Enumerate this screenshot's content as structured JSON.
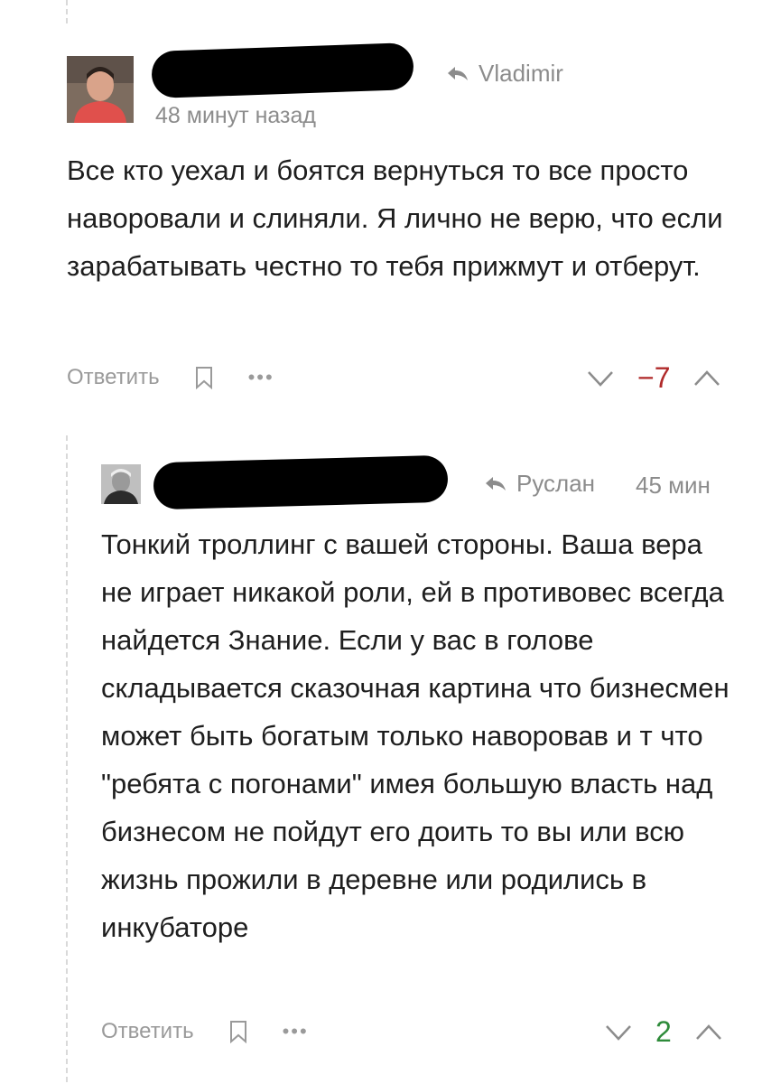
{
  "comments": [
    {
      "reply_to": "Vladimir",
      "time": "48 минут назад",
      "text": "Все кто уехал и боятся вернуться то все просто наворовали и слиняли. Я лично не верю, что если зарабатывать честно то тебя прижмут и отберут.",
      "actions": {
        "reply": "Ответить"
      },
      "rating": "−7",
      "rating_color": "#b02a2a",
      "icons": [
        "reply-arrow-icon",
        "bookmark-icon",
        "more-dots-icon",
        "chevron-down-icon",
        "chevron-up-icon"
      ]
    },
    {
      "reply_to": "Руслан",
      "time": "45 мин",
      "text": "Тонкий троллинг с вашей стороны. Ваша вера не играет никакой роли, ей в противовес всегда найдется Знание. Если у вас в голове складывается сказочная картина что бизнесмен может быть богатым только наворовав и т что \"ребята с погонами\" имея большую власть над бизнесом не пойдут его доить то вы или всю жизнь прожили в деревне или родились в инкубаторе",
      "actions": {
        "reply": "Ответить"
      },
      "rating": "2",
      "rating_color": "#2e8b3a",
      "icons": [
        "reply-arrow-icon",
        "bookmark-icon",
        "more-dots-icon",
        "chevron-down-icon",
        "chevron-up-icon"
      ]
    }
  ],
  "more_symbol": "•••",
  "colors": {
    "muted": "#8c8c8c",
    "text": "#1e1e1e",
    "negative": "#b02a2a",
    "positive": "#2e8b3a"
  }
}
